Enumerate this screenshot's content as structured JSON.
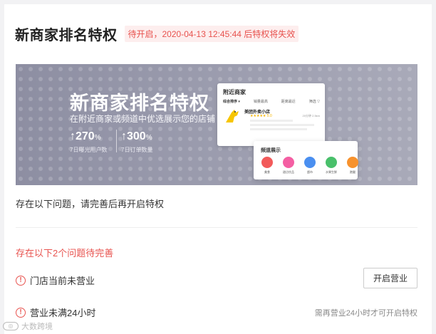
{
  "header": {
    "title": "新商家排名特权",
    "badge": "待开启，2020-04-13 12:45:44 后特权将失效"
  },
  "banner": {
    "title": "新商家排名特权",
    "subtitle": "在附近商家或频道中优选展示您的店铺",
    "stats": [
      {
        "value": "↑270",
        "unit": "%",
        "label": "7日曝光用户数"
      },
      {
        "value": "↑300",
        "unit": "%",
        "label": "7日订单数量"
      }
    ],
    "mock": {
      "heading": "附近商家",
      "tabs": [
        "综合排序 ▾",
        "销量最高",
        "距离最近",
        "筛选 ▽"
      ],
      "shop_name": "美团外卖小店",
      "shop_distance": "20分钟  2.5km",
      "stars": "★★★★★ 5.0"
    },
    "popup": {
      "heading": "频道展示",
      "items": [
        {
          "label": "美食",
          "color": "#f25a5a"
        },
        {
          "label": "甜点饮品",
          "color": "#f45fa3"
        },
        {
          "label": "超市",
          "color": "#4a8ff0"
        },
        {
          "label": "水果生鲜",
          "color": "#49c06b"
        },
        {
          "label": "跑腿",
          "color": "#f7922e"
        }
      ]
    }
  },
  "notice": "存在以下问题，请完善后再开启特权",
  "issues_count": "存在以下2个问题待完善",
  "issues": [
    {
      "text": "门店当前未营业",
      "action": "开启营业"
    },
    {
      "text": "营业未满24小时",
      "hint": "需再营业24小时才可开启特权"
    }
  ],
  "watermark": "大数跨境",
  "colors": {
    "accent": "#e8534f",
    "banner": "#9a9bad"
  }
}
